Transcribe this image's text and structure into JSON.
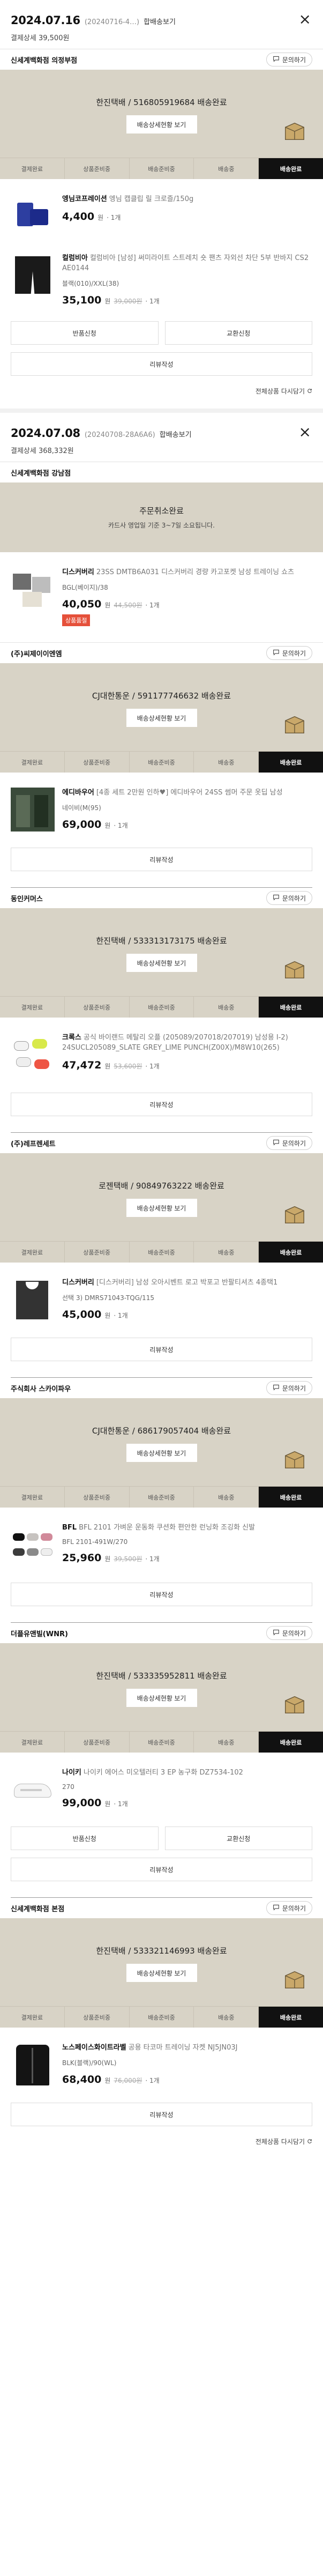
{
  "common": {
    "ask_label": "문의하기",
    "track_label": "배송상세현황 보기",
    "steps": [
      "결제완료",
      "상품준비중",
      "배송준비중",
      "배송중",
      "배송완료"
    ],
    "review_label": "리뷰작성",
    "exchange_label": "교환신청",
    "return_label": "반품신청",
    "again_label": "전체상품 다시담기",
    "qty_label": "1개"
  },
  "orders": [
    {
      "date": "2024.07.16",
      "order_no": "(20240716-4…)",
      "mode": "합배송보기",
      "paysum": "결제상세 39,500원",
      "sellers": [
        {
          "name": "신세계백화점 의정부점",
          "shipping": "한진택배 / 516805919684 배송완료",
          "items": [
            {
              "brand": "엥님코프레이션",
              "name": "엥님 캡클립 릴 크로즐/150g",
              "option": "",
              "price": "4,400",
              "orig": "",
              "unit": "원"
            },
            {
              "brand": "컬럼비아",
              "name": "컬럼비아 [남성] 써미라이트 스트레치 숏 팬츠 자외선 차단 5부 반바지 CS2 AE0144",
              "option": "블랙(010)/XXL(38)",
              "price": "35,100",
              "orig": "39,000원",
              "unit": "원"
            }
          ]
        }
      ]
    },
    {
      "date": "2024.07.08",
      "order_no": "(20240708-28A6A6)",
      "mode": "합배송보기",
      "paysum": "결제상세 368,332원",
      "cancel": {
        "seller": "신세계백화점 강남점",
        "title": "주문취소완료",
        "sub": "카드사 영업일 기준 3~7일 소요됩니다.",
        "brand": "디스커버리",
        "name": "23SS DMTB6A031 디스커버리 경량 카고포켓 남성 트레이닝 쇼츠",
        "option": "BGL(베이지)/38",
        "price": "40,050",
        "orig": "44,500원",
        "badge": "상품품절"
      },
      "sellers": [
        {
          "name": "(주)씨제이이엔엠",
          "shipping": "CJ대한통운 / 591177746632 배송완료",
          "items": [
            {
              "brand": "에디바우어",
              "name": "[4종 세트 2만원 인하♥] 에디바우어 24SS 썸머 주문 옷딥 남성",
              "option": "네이비(M(95)",
              "price": "69,000",
              "orig": "",
              "unit": "원"
            }
          ]
        },
        {
          "name": "동인커머스",
          "shipping": "한진택배 / 533313173175 배송완료",
          "items": [
            {
              "brand": "크록스",
              "name": "공식 바이랜드 메탈리 오플 (205089/207018/207019) 남성용 I-2) 24SUCL205089_SLATE GREY_LIME PUNCH(Z00X)/M8W10(265)",
              "option": "",
              "price": "47,472",
              "orig": "53,600원",
              "unit": "원"
            }
          ]
        },
        {
          "name": "(주)레프렌세트",
          "shipping": "로젠택배 / 90849763222 배송완료",
          "items": [
            {
              "brand": "디스커버리",
              "name": "[디스커버리] 남성 오아시벤트 로고 박포고 반팔티셔츠 4종택1",
              "option": "선택 3) DMRS71043-TQG/115",
              "price": "45,000",
              "orig": "",
              "unit": "원"
            }
          ]
        },
        {
          "name": "주식회사 스카이파우",
          "shipping": "CJ대한통운 / 686179057404 배송완료",
          "items": [
            {
              "brand": "BFL",
              "name": "BFL 2101 가벼운 운동화 쿠션화 편안한 런닝화 조깅화 신발",
              "option": "BFL 2101-491W/270",
              "price": "25,960",
              "orig": "39,500원",
              "unit": "원"
            }
          ]
        },
        {
          "name": "더플유앤빌(WNR)",
          "shipping": "한진택배 / 533335952811 배송완료",
          "items": [
            {
              "brand": "나이키",
              "name": "나이키 에어스 미오텔러티 3 EP 농구화 DZ7534-102",
              "option": "270",
              "price": "99,000",
              "orig": "",
              "unit": "원"
            }
          ]
        },
        {
          "name": "신세계백화점 본점",
          "shipping": "한진택배 / 533321146993 배송완료",
          "items": [
            {
              "brand": "노스페이스화이트라벨",
              "name": "공용 타코마 트레이닝 자켓 NJ5JN03J",
              "option": "BLK(블랙)/90(WL)",
              "price": "68,400",
              "orig": "76,000원",
              "unit": "원"
            }
          ]
        }
      ]
    }
  ]
}
